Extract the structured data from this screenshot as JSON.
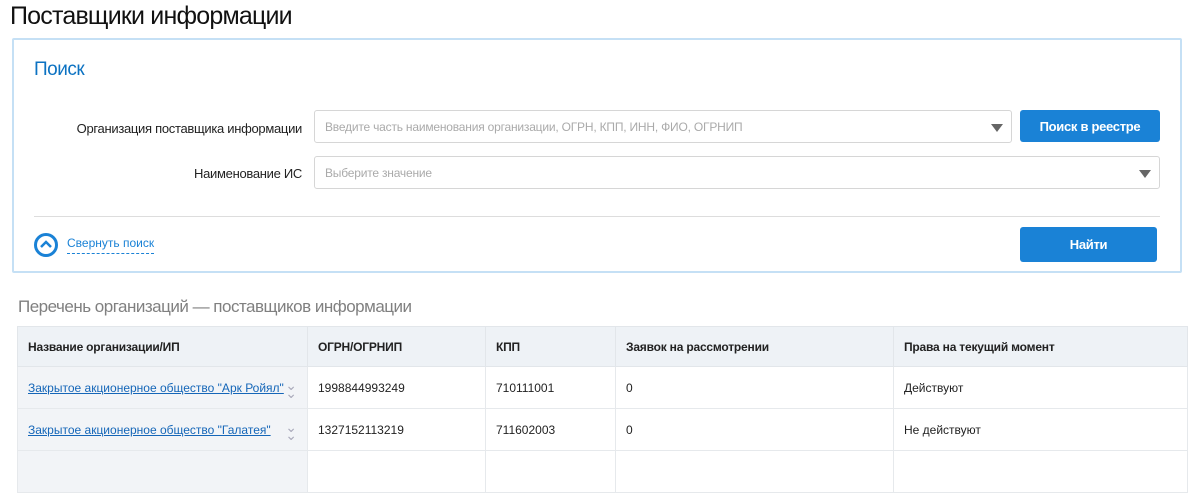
{
  "page_title": "Поставщики информации",
  "search": {
    "heading": "Поиск",
    "org_label": "Организация поставщика информации",
    "org_placeholder": "Введите часть наименования организации, ОГРН, КПП, ИНН, ФИО, ОГРНИП",
    "registry_button": "Поиск в реестре",
    "is_label": "Наименование ИС",
    "is_placeholder": "Выберите значение",
    "collapse_label": "Свернуть поиск",
    "find_button": "Найти"
  },
  "list": {
    "heading": "Перечень организаций — поставщиков информации",
    "columns": [
      "Название организации/ИП",
      "ОГРН/ОГРНИП",
      "КПП",
      "Заявок на рассмотрении",
      "Права на текущий момент"
    ],
    "rows": [
      [
        "Закрытое акционерное общество \"Арк Ройял\"",
        "1998844993249",
        "710111001",
        "0",
        "Действуют"
      ],
      [
        "Закрытое акционерное общество \"Галатея\"",
        "1327152113219",
        "711602003",
        "0",
        "Не действуют"
      ]
    ]
  },
  "colors": {
    "accent": "#1a82d6",
    "panel_border": "#c5e0f5"
  }
}
